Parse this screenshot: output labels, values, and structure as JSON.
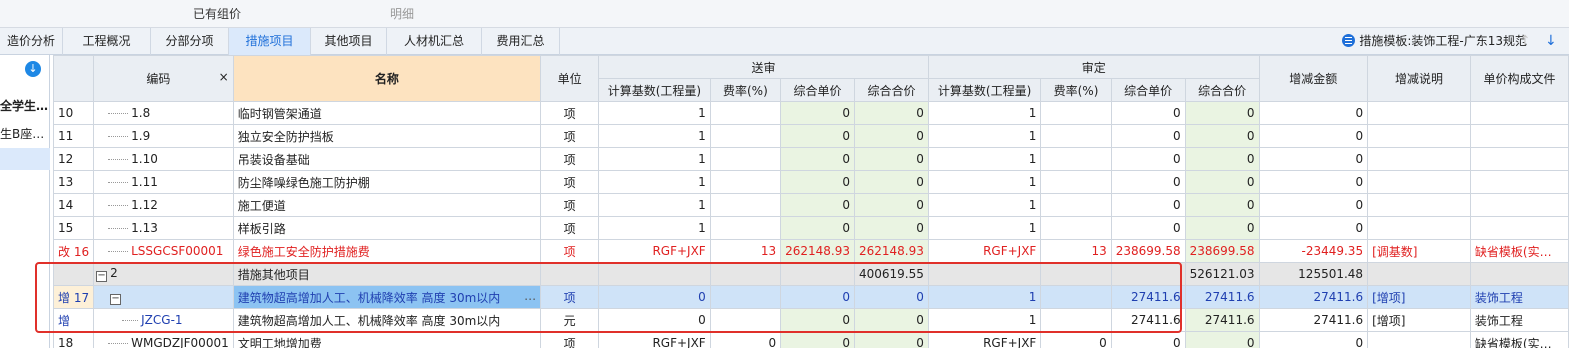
{
  "ribbon": {
    "item1": "已有组价",
    "item2": "明细"
  },
  "tabs": [
    "造价分析",
    "工程概况",
    "分部分项",
    "措施项目",
    "其他项目",
    "人材机汇总",
    "费用汇总"
  ],
  "template_label": "措施模板:装饰工程-广东13规范",
  "sidebar": {
    "items": [
      "全学生…",
      "生B座…"
    ]
  },
  "headers": {
    "code": "编码",
    "close": "×",
    "name": "名称",
    "unit": "单位",
    "group_submit": "送审",
    "group_approve": "审定",
    "calc_base": "计算基数(工程量)",
    "rate": "费率(%)",
    "unit_price": "综合单价",
    "total_price": "综合合价",
    "calc_base2": "计算基数(工程量)",
    "rate2": "费率(%)",
    "unit_price2": "综合单价",
    "total_price2": "综合合价",
    "delta": "增减金额",
    "delta_note": "增减说明",
    "composition": "单价构成文件"
  },
  "rows": [
    {
      "idx": "10",
      "code": "1.8",
      "name": "临时钢管架通道",
      "unit": "项",
      "s_base": "1",
      "s_rate": "",
      "s_up": "0",
      "s_tp": "0",
      "a_base": "1",
      "a_rate": "",
      "a_up": "0",
      "a_tp": "0",
      "delta": "0",
      "note": "",
      "comp": ""
    },
    {
      "idx": "11",
      "code": "1.9",
      "name": "独立安全防护挡板",
      "unit": "项",
      "s_base": "1",
      "s_rate": "",
      "s_up": "0",
      "s_tp": "0",
      "a_base": "1",
      "a_rate": "",
      "a_up": "0",
      "a_tp": "0",
      "delta": "0",
      "note": "",
      "comp": ""
    },
    {
      "idx": "12",
      "code": "1.10",
      "name": "吊装设备基础",
      "unit": "项",
      "s_base": "1",
      "s_rate": "",
      "s_up": "0",
      "s_tp": "0",
      "a_base": "1",
      "a_rate": "",
      "a_up": "0",
      "a_tp": "0",
      "delta": "0",
      "note": "",
      "comp": ""
    },
    {
      "idx": "13",
      "code": "1.11",
      "name": "防尘降噪绿色施工防护棚",
      "unit": "项",
      "s_base": "1",
      "s_rate": "",
      "s_up": "0",
      "s_tp": "0",
      "a_base": "1",
      "a_rate": "",
      "a_up": "0",
      "a_tp": "0",
      "delta": "0",
      "note": "",
      "comp": ""
    },
    {
      "idx": "14",
      "code": "1.12",
      "name": "施工便道",
      "unit": "项",
      "s_base": "1",
      "s_rate": "",
      "s_up": "0",
      "s_tp": "0",
      "a_base": "1",
      "a_rate": "",
      "a_up": "0",
      "a_tp": "0",
      "delta": "0",
      "note": "",
      "comp": ""
    },
    {
      "idx": "15",
      "code": "1.13",
      "name": "样板引路",
      "unit": "项",
      "s_base": "1",
      "s_rate": "",
      "s_up": "0",
      "s_tp": "0",
      "a_base": "1",
      "a_rate": "",
      "a_up": "0",
      "a_tp": "0",
      "delta": "0",
      "note": "",
      "comp": ""
    },
    {
      "mark": "改",
      "idx": "16",
      "code": "LSSGCSF00001",
      "name": "绿色施工安全防护措施费",
      "unit": "项",
      "s_base": "RGF+JXF",
      "s_rate": "13",
      "s_up": "262148.93",
      "s_tp": "262148.93",
      "a_base": "RGF+JXF",
      "a_rate": "13",
      "a_up": "238699.58",
      "a_tp": "238699.58",
      "delta": "-23449.35",
      "note": "[调基数]",
      "comp": "缺省模板(实…"
    },
    {
      "idx": "",
      "code": "2",
      "name": "措施其他项目",
      "unit": "",
      "s_base": "",
      "s_rate": "",
      "s_up": "",
      "s_tp": "400619.55",
      "a_base": "",
      "a_rate": "",
      "a_up": "",
      "a_tp": "526121.03",
      "delta": "125501.48",
      "note": "",
      "comp": ""
    },
    {
      "mark": "增",
      "idx": "17",
      "code": "",
      "name": "建筑物超高增加人工、机械降效率 高度 30m以内",
      "name_more": "…",
      "unit": "项",
      "s_base": "0",
      "s_rate": "",
      "s_up": "0",
      "s_tp": "0",
      "a_base": "1",
      "a_rate": "",
      "a_up": "27411.6",
      "a_tp": "27411.6",
      "delta": "27411.6",
      "note": "[增项]",
      "comp": "装饰工程"
    },
    {
      "mark": "增",
      "idx": "",
      "code": "JZCG-1",
      "name": "建筑物超高增加人工、机械降效率 高度 30m以内",
      "unit": "元",
      "s_base": "0",
      "s_rate": "",
      "s_up": "0",
      "s_tp": "0",
      "a_base": "1",
      "a_rate": "",
      "a_up": "27411.6",
      "a_tp": "27411.6",
      "delta": "27411.6",
      "note": "[增项]",
      "comp": "装饰工程"
    },
    {
      "idx": "18",
      "code": "WMGDZJF00001",
      "name": "文明工地增加费",
      "unit": "项",
      "s_base": "RGF+JXF",
      "s_rate": "0",
      "s_up": "0",
      "s_tp": "0",
      "a_base": "RGF+JXF",
      "a_rate": "0",
      "a_up": "0",
      "a_tp": "0",
      "delta": "0",
      "note": "",
      "comp": "缺省模板(实…"
    }
  ]
}
